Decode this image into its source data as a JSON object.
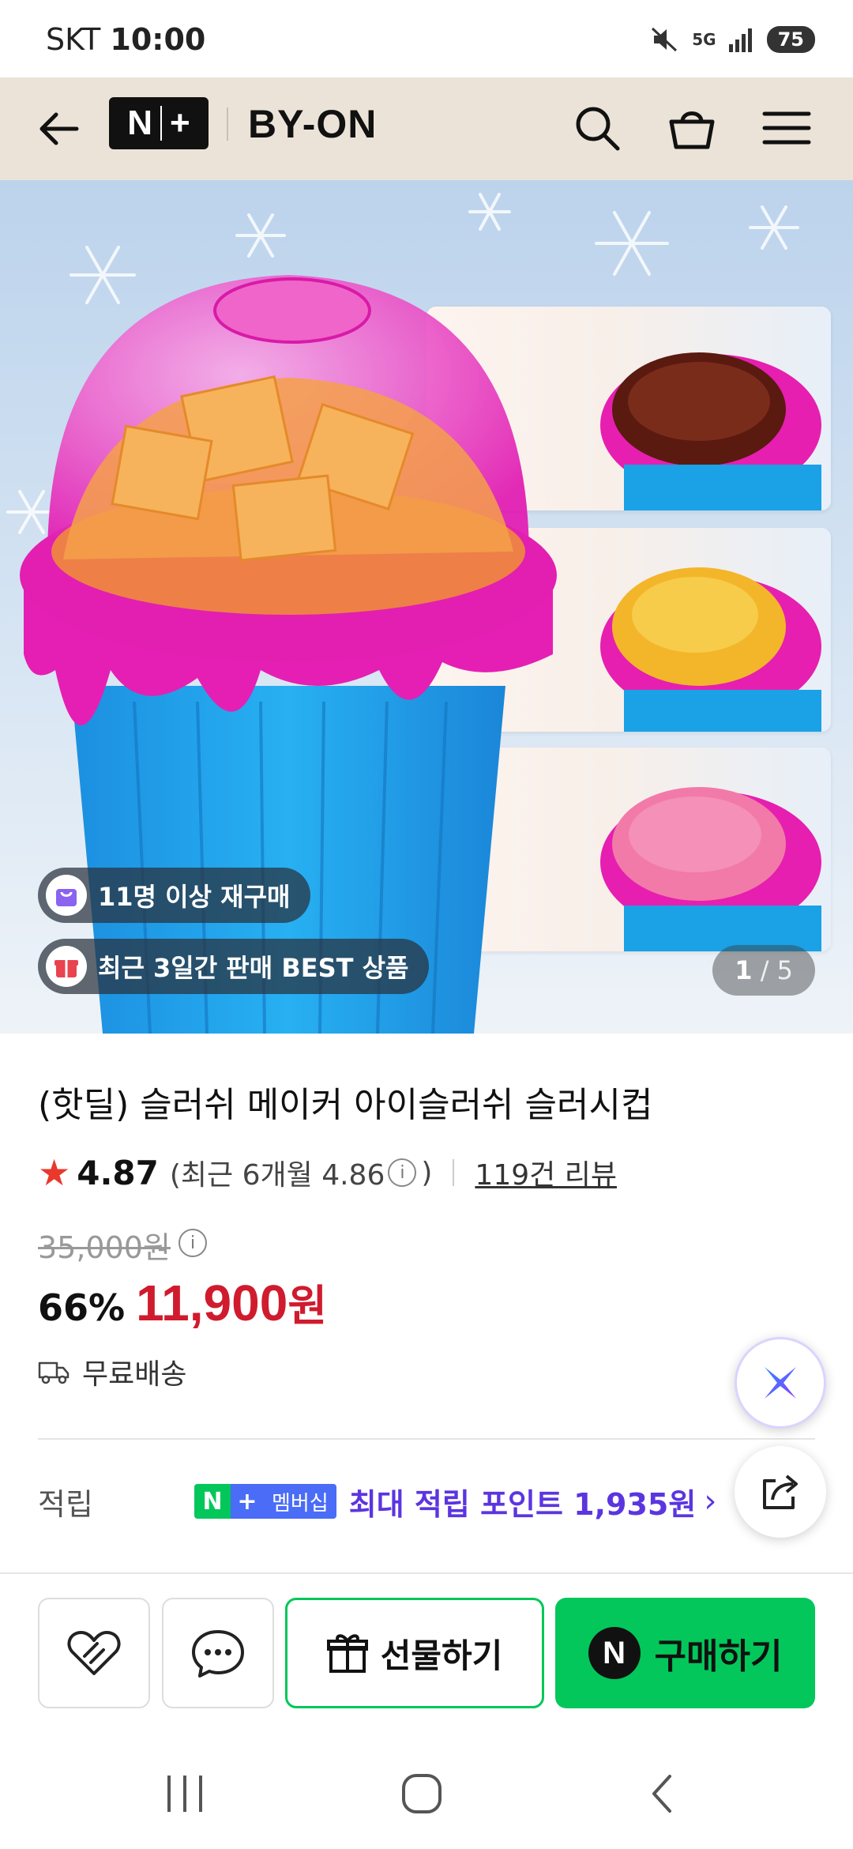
{
  "status_bar": {
    "carrier": "SKT",
    "time": "10:00",
    "network": "5G",
    "battery": "75"
  },
  "header": {
    "logo_text": "N",
    "logo_plus": "+",
    "store_name": "BY-ON"
  },
  "product_image": {
    "badges": [
      {
        "icon": "shopping-bag-icon",
        "text": "11명 이상 재구매",
        "color": "#8a63f0"
      },
      {
        "icon": "gift-icon",
        "text": "최근 3일간 판매 BEST 상품",
        "color": "#e8434f"
      }
    ],
    "pager": {
      "current": "1",
      "separator": "/",
      "total": "5"
    }
  },
  "product": {
    "title": "(핫딜) 슬러쉬 메이커 아이슬러쉬 슬러시컵",
    "rating": "4.87",
    "rating_recent": "(최근 6개월 4.86",
    "rating_recent_close": ")",
    "info_glyph": "i",
    "review_count": "119건 리뷰",
    "original_price": "35,000원",
    "discount": "66%",
    "sale_price": "11,900",
    "sale_unit": "원",
    "shipping": "무료배송"
  },
  "points": {
    "label": "적립",
    "badge_n": "N",
    "badge_plus": "+",
    "badge_text": "멤버십",
    "text": "최대 적립 포인트 1,935원",
    "chevron": "›"
  },
  "actions": {
    "gift_label": "선물하기",
    "buy_label": "구매하기",
    "buy_icon_text": "N"
  },
  "colors": {
    "header_bg": "#ece3d8",
    "naver_green": "#03c75a",
    "sale_red": "#d01b2e",
    "points_purple": "#5b35e0"
  }
}
